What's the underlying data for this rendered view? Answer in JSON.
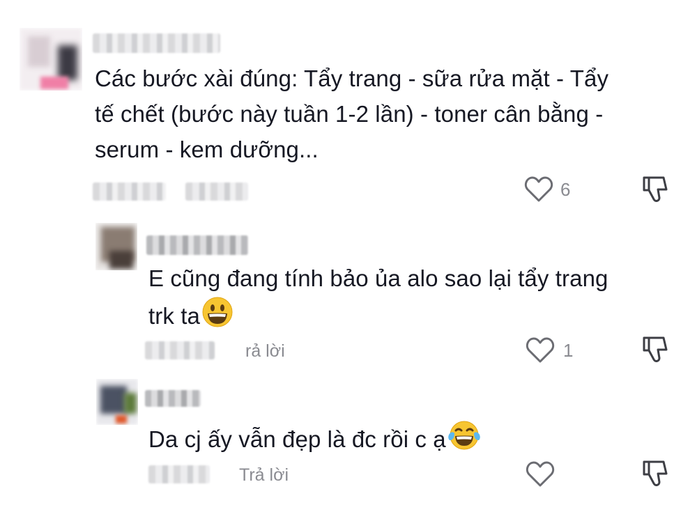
{
  "comments": [
    {
      "text": "Các bước xài đúng: Tẩy trang - sữa rửa mặt - Tẩy tế chết (bước này tuần 1-2 lần) - toner cân bằng - serum - kem dưỡng...",
      "lines": [
        "Các bước xài đúng: Tẩy trang - sữa rửa mặt - Tẩy",
        "tế chết (bước này tuần 1-2 lần) - toner cân bằng -",
        "serum - kem dưỡng..."
      ],
      "likes": "6",
      "like_icon": "heart-outline-icon",
      "dislike_icon": "thumbs-down-outline-icon"
    }
  ],
  "replies": [
    {
      "lines": [
        "E cũng đang tính bảo ủa alo sao lại tẩy trang",
        "trk ta"
      ],
      "emoji": "grinning-face-emoji",
      "reply_label": "rả lời",
      "likes": "1"
    },
    {
      "lines": [
        "Da cj ấy vẫn đẹp là đc rồi c ạ"
      ],
      "emoji": "tears-of-joy-emoji",
      "reply_label": "Trả lời",
      "likes": ""
    }
  ],
  "colors": {
    "text": "#161823",
    "meta": "#8a8b91",
    "emoji": "#f7c531"
  }
}
